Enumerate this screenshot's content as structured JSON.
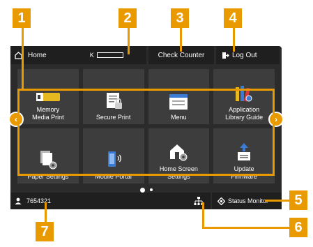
{
  "topbar": {
    "home_label": "Home",
    "toner_label": "K",
    "check_counter_label": "Check Counter",
    "logout_label": "Log Out"
  },
  "tiles": [
    {
      "label": "Memory\nMedia Print",
      "icon": "memory-card-icon"
    },
    {
      "label": "Secure Print",
      "icon": "secure-print-icon"
    },
    {
      "label": "Menu",
      "icon": "menu-icon"
    },
    {
      "label": "Application\nLibrary Guide",
      "icon": "application-library-icon"
    },
    {
      "label": "Paper Settings",
      "icon": "paper-settings-icon"
    },
    {
      "label": "Mobile Portal",
      "icon": "mobile-portal-icon"
    },
    {
      "label": "Home Screen\nSettings",
      "icon": "home-screen-settings-icon"
    },
    {
      "label": "Update\nFirmware",
      "icon": "update-firmware-icon"
    }
  ],
  "pager": {
    "current_page": 1,
    "total_pages": 2
  },
  "bottombar": {
    "user_id": "7654321",
    "status_monitor_label": "Status Monitor"
  },
  "callouts": [
    "1",
    "2",
    "3",
    "4",
    "5",
    "6",
    "7"
  ],
  "colors": {
    "accent": "#e89a00",
    "screen_bg": "#2b2b2b",
    "bar_bg": "#1f1f1f",
    "tile_bg": "#3d3d3d"
  }
}
